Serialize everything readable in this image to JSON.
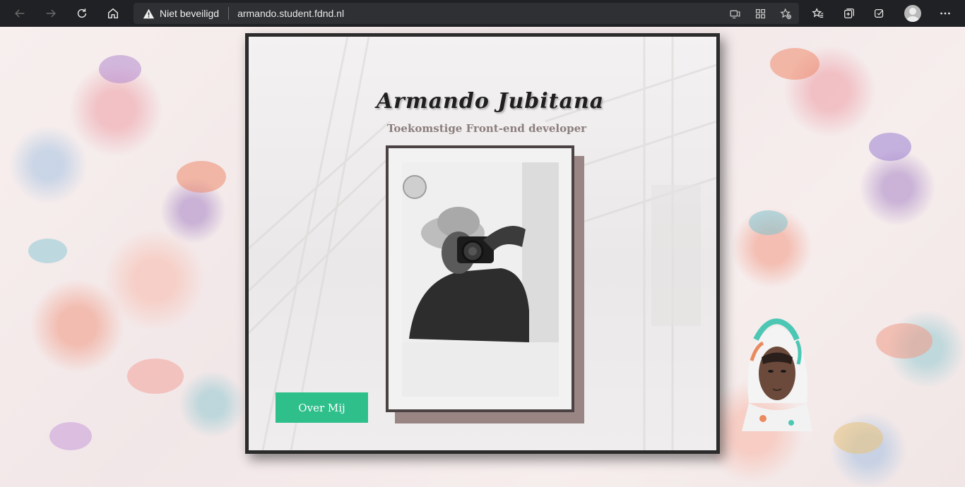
{
  "browser": {
    "security_label": "Niet beveiligd",
    "url": "armando.student.fdnd.nl",
    "icons": {
      "back": "back-arrow-icon",
      "forward": "forward-arrow-icon",
      "reload": "reload-icon",
      "home": "home-icon",
      "warning": "warning-icon",
      "read_aloud": "immersive-reader-icon",
      "apps": "apps-icon",
      "add_favorite": "add-favorite-icon",
      "favorites": "favorites-icon",
      "collections": "collections-icon",
      "extensions": "extensions-icon",
      "profile": "profile-avatar",
      "more": "more-menu-icon"
    }
  },
  "page": {
    "name": "Armando Jubitana",
    "subtitle": "Toekomstige Front-end developer",
    "button_label": "Over Mij",
    "colors": {
      "button": "#2fbf8b",
      "card_border": "#2b2b2b",
      "photo_shadow": "#9a8585",
      "subtitle": "#8c7e7e"
    }
  }
}
